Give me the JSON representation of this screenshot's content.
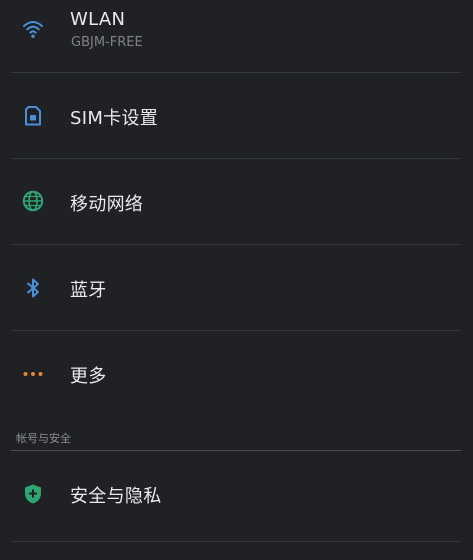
{
  "settings": {
    "wlan": {
      "title": "WLAN",
      "subtitle": "GBJM-FREE",
      "icon": "wifi-icon"
    },
    "sim": {
      "title": "SIM卡设置",
      "icon": "sim-card-icon"
    },
    "mobile": {
      "title": "移动网络",
      "icon": "globe-icon"
    },
    "bluetooth": {
      "title": "蓝牙",
      "icon": "bluetooth-icon"
    },
    "more": {
      "title": "更多",
      "icon": "more-dots-icon"
    },
    "account_section": {
      "header": "帐号与安全"
    },
    "privacy": {
      "title": "安全与隐私",
      "icon": "shield-plus-icon"
    }
  },
  "colors": {
    "background": "#1f2125",
    "wifi": "#4a90d9",
    "sim": "#4a90d9",
    "globe": "#2fa572",
    "bluetooth": "#4a90d9",
    "more": "#e0892f",
    "shield": "#2fa572"
  }
}
